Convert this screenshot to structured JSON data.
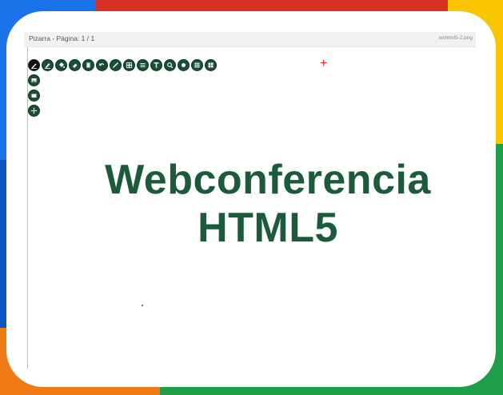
{
  "window": {
    "title": "Pizarra - Página: 1 / 1",
    "file": "wchtml5-2.png"
  },
  "toolbar": {
    "tools": [
      {
        "name": "pen-tool",
        "icon": "pen-icon",
        "active": true
      },
      {
        "name": "marker-tool",
        "icon": "marker-icon"
      },
      {
        "name": "fill-tool",
        "icon": "paint-bucket-icon"
      },
      {
        "name": "eraser-tool",
        "icon": "eraser-icon"
      },
      {
        "name": "trash-tool",
        "icon": "trash-icon"
      },
      {
        "name": "undo-tool",
        "icon": "undo-icon"
      },
      {
        "name": "line-tool",
        "icon": "line-icon"
      },
      {
        "name": "grid-tool",
        "icon": "grid-icon"
      },
      {
        "name": "list-tool",
        "icon": "list-icon"
      },
      {
        "name": "text-tool",
        "icon": "text-icon"
      },
      {
        "name": "zoom-tool",
        "icon": "magnifier-icon"
      },
      {
        "name": "shape-tool",
        "icon": "circle-icon"
      },
      {
        "name": "table-tool",
        "icon": "table-icon"
      }
    ],
    "side_tools": [
      {
        "name": "image-tool",
        "icon": "image-icon"
      },
      {
        "name": "folder-tool",
        "icon": "folder-icon"
      },
      {
        "name": "move-tool",
        "icon": "move-icon"
      }
    ]
  },
  "content": {
    "line1": "Webconferencia",
    "line2": "HTML5"
  },
  "colors": {
    "accent": "#1b5a3a",
    "cursor": "#d93025"
  }
}
